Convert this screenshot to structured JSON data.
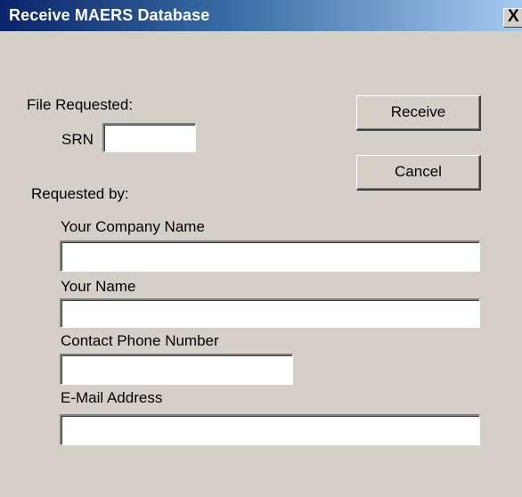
{
  "window": {
    "title": "Receive MAERS Database",
    "close_glyph": "X"
  },
  "file_requested": {
    "label": "File Requested:",
    "srn_label": "SRN",
    "srn_value": ""
  },
  "requested_by": {
    "label": "Requested by:",
    "company_label": "Your Company Name",
    "company_value": "",
    "name_label": "Your Name",
    "name_value": "",
    "phone_label": "Contact Phone Number",
    "phone_value": "",
    "email_label": "E-Mail Address",
    "email_value": ""
  },
  "buttons": {
    "receive": "Receive",
    "cancel": "Cancel"
  },
  "colors": {
    "titlebar_start": "#0a246a",
    "titlebar_end": "#a6caf0",
    "dialog_face": "#d4d0c8"
  }
}
